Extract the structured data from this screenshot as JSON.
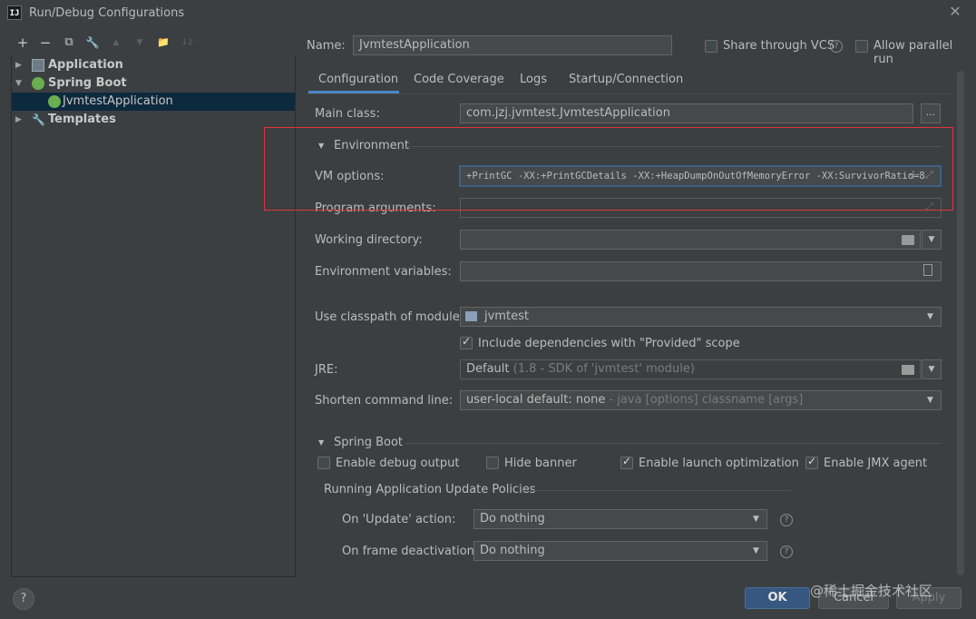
{
  "window": {
    "title": "Run/Debug Configurations",
    "app_icon": "IJ"
  },
  "toolbar": {
    "add": "+",
    "remove": "−",
    "copy": "⧉",
    "edit_defaults": "🔧",
    "move_up": "▲",
    "move_down": "▼",
    "new_folder": "📁",
    "sort": "↓z"
  },
  "tree": {
    "items": [
      {
        "label": "Application"
      },
      {
        "label": "Spring Boot"
      },
      {
        "label": "JvmtestApplication"
      },
      {
        "label": "Templates"
      }
    ]
  },
  "header": {
    "name_label": "Name:",
    "name_value": "JvmtestApplication",
    "share_vcs": "Share through VCS",
    "allow_parallel": "Allow parallel run"
  },
  "tabs": [
    {
      "label": "Configuration"
    },
    {
      "label": "Code Coverage"
    },
    {
      "label": "Logs"
    },
    {
      "label": "Startup/Connection"
    }
  ],
  "config": {
    "main_class_label": "Main class:",
    "main_class_value": "com.jzj.jvmtest.JvmtestApplication",
    "browse": "...",
    "environment_section": "Environment",
    "vm_options_label": "VM options:",
    "vm_options_value": "+PrintGC -XX:+PrintGCDetails -XX:+HeapDumpOnOutOfMemoryError -XX:SurvivorRatio=8",
    "program_args_label": "Program arguments:",
    "working_dir_label": "Working directory:",
    "env_vars_label": "Environment variables:",
    "classpath_label": "Use classpath of module:",
    "classpath_value": "jvmtest",
    "include_deps": "Include dependencies with \"Provided\" scope",
    "jre_label": "JRE:",
    "jre_value": "Default",
    "jre_hint": "(1.8 - SDK of 'jvmtest' module)",
    "shorten_label": "Shorten command line:",
    "shorten_value": "user-local default: none",
    "shorten_hint": "- java [options] classname [args]"
  },
  "spring": {
    "section": "Spring Boot",
    "debug_output": "Enable debug output",
    "hide_banner": "Hide banner",
    "launch_opt": "Enable launch optimization",
    "jmx_agent": "Enable JMX agent",
    "policies_title": "Running Application Update Policies",
    "on_update_label": "On 'Update' action:",
    "on_update_value": "Do nothing",
    "on_frame_label": "On frame deactivation:",
    "on_frame_value": "Do nothing"
  },
  "footer": {
    "help": "?",
    "ok": "OK",
    "cancel": "Cancel",
    "apply": "Apply"
  },
  "watermark": "@稀土掘金技术社区",
  "colors": {
    "background": "#3c3f41",
    "selection": "#0d293e",
    "accent": "#4a88c7",
    "ok_button": "#365880",
    "highlight_box": "#e0353d"
  }
}
